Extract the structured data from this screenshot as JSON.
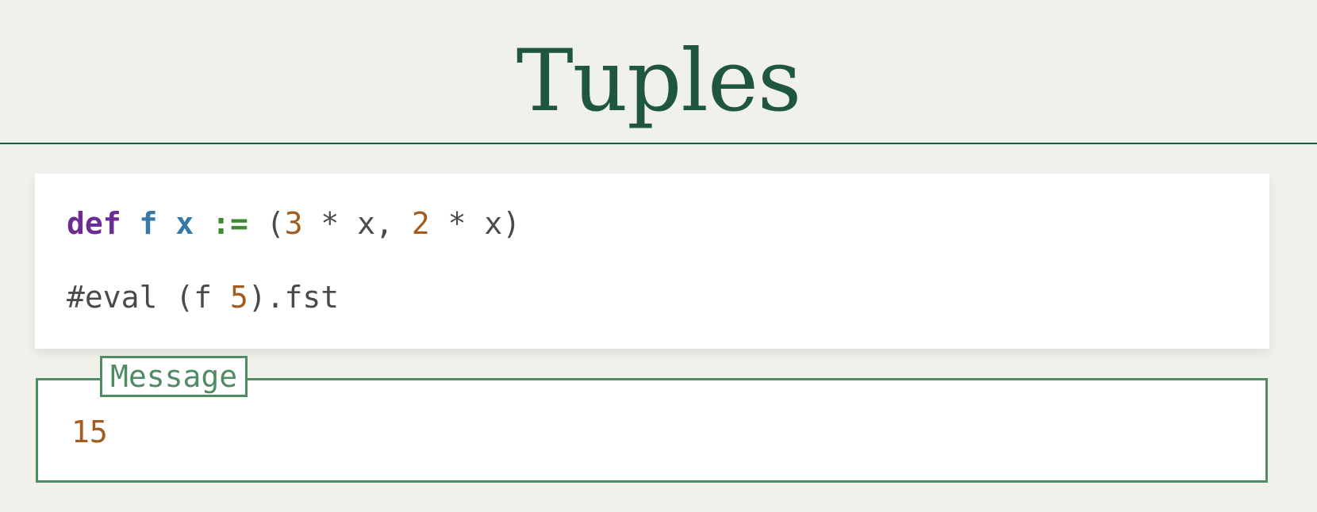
{
  "page": {
    "title": "Tuples"
  },
  "code": {
    "line1": {
      "keyword": "def",
      "name": "f",
      "param": "x",
      "assign": ":=",
      "open": "(",
      "num1": "3",
      "mid1": " * x, ",
      "num2": "2",
      "mid2": " * x)"
    },
    "line2": {
      "prefix": "#eval (f ",
      "num": "5",
      "suffix": ").fst"
    }
  },
  "message": {
    "label": "Message",
    "value": "15"
  },
  "colors": {
    "title": "#1f5641",
    "keyword": "#6d2c91",
    "function": "#3579a6",
    "operator": "#3c8b2f",
    "number": "#a15c1f",
    "message_border": "#4f8b63",
    "background": "#f0f1eb"
  }
}
